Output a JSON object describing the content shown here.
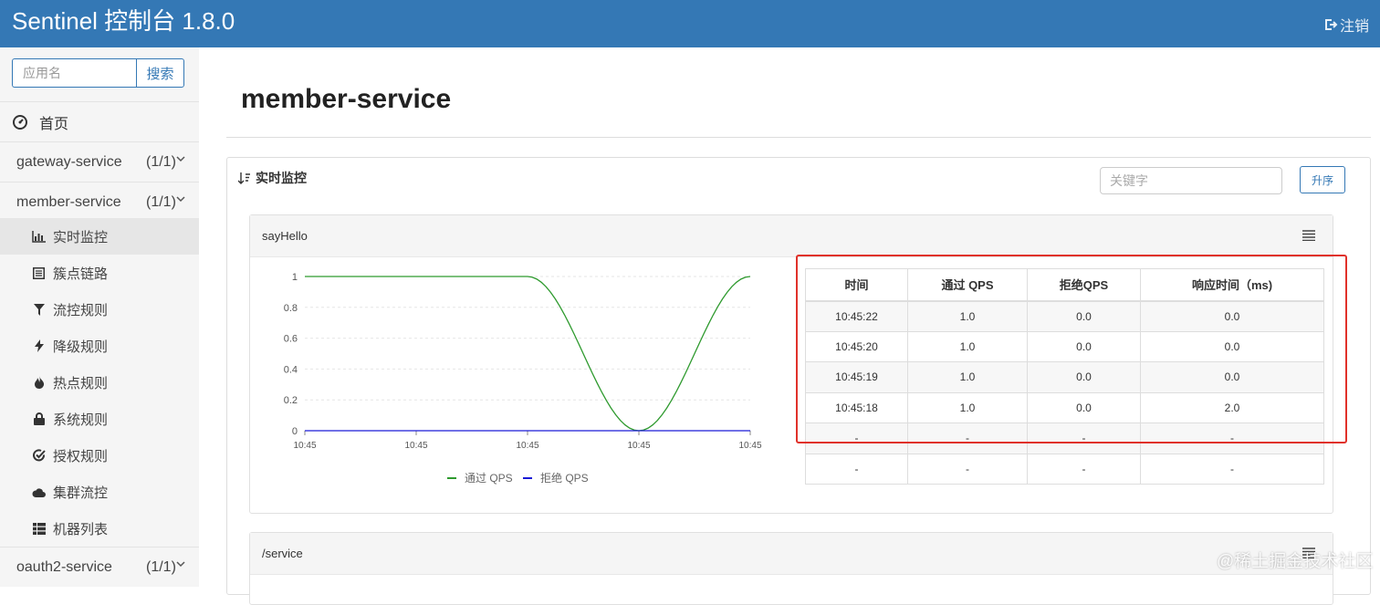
{
  "header": {
    "brand": "Sentinel 控制台 1.8.0",
    "logout_label": "注销"
  },
  "sidebar": {
    "search_placeholder": "应用名",
    "search_button": "搜索",
    "home_label": "首页",
    "apps": [
      {
        "name": "gateway-service",
        "count": "(1/1)"
      },
      {
        "name": "member-service",
        "count": "(1/1)"
      },
      {
        "name": "oauth2-service",
        "count": "(1/1)"
      }
    ],
    "sub_items": [
      {
        "label": "实时监控",
        "icon": "bar-chart-icon"
      },
      {
        "label": "簇点链路",
        "icon": "list-icon"
      },
      {
        "label": "流控规则",
        "icon": "filter-icon"
      },
      {
        "label": "降级规则",
        "icon": "bolt-icon"
      },
      {
        "label": "热点规则",
        "icon": "fire-icon"
      },
      {
        "label": "系统规则",
        "icon": "lock-icon"
      },
      {
        "label": "授权规则",
        "icon": "check-circle-icon"
      },
      {
        "label": "集群流控",
        "icon": "cloud-icon"
      },
      {
        "label": "机器列表",
        "icon": "table-icon"
      }
    ]
  },
  "main": {
    "title": "member-service",
    "panel_title": "实时监控",
    "keyword_placeholder": "关键字",
    "sort_button": "升序",
    "resources": [
      {
        "name": "sayHello",
        "table": {
          "headers": [
            "时间",
            "通过 QPS",
            "拒绝QPS",
            "响应时间（ms)"
          ],
          "rows": [
            [
              "10:45:22",
              "1.0",
              "0.0",
              "0.0"
            ],
            [
              "10:45:20",
              "1.0",
              "0.0",
              "0.0"
            ],
            [
              "10:45:19",
              "1.0",
              "0.0",
              "0.0"
            ],
            [
              "10:45:18",
              "1.0",
              "0.0",
              "2.0"
            ],
            [
              "-",
              "-",
              "-",
              "-"
            ],
            [
              "-",
              "-",
              "-",
              "-"
            ]
          ]
        }
      },
      {
        "name": "/service"
      }
    ]
  },
  "chart_data": {
    "type": "line",
    "x": [
      "10:45",
      "10:45",
      "10:45",
      "10:45",
      "10:45"
    ],
    "y_ticks": [
      "0",
      "0.2",
      "0.4",
      "0.6",
      "0.8",
      "1"
    ],
    "ylim": [
      0,
      1
    ],
    "series": [
      {
        "name": "通过 QPS",
        "color": "#2e9a2e",
        "values": [
          1,
          1,
          1,
          0,
          1
        ]
      },
      {
        "name": "拒绝 QPS",
        "color": "#1a1ad6",
        "values": [
          0,
          0,
          0,
          0,
          0
        ]
      }
    ],
    "grid": "horizontal",
    "legend": "bottom-center"
  },
  "watermark": "@稀土掘金技术社区"
}
